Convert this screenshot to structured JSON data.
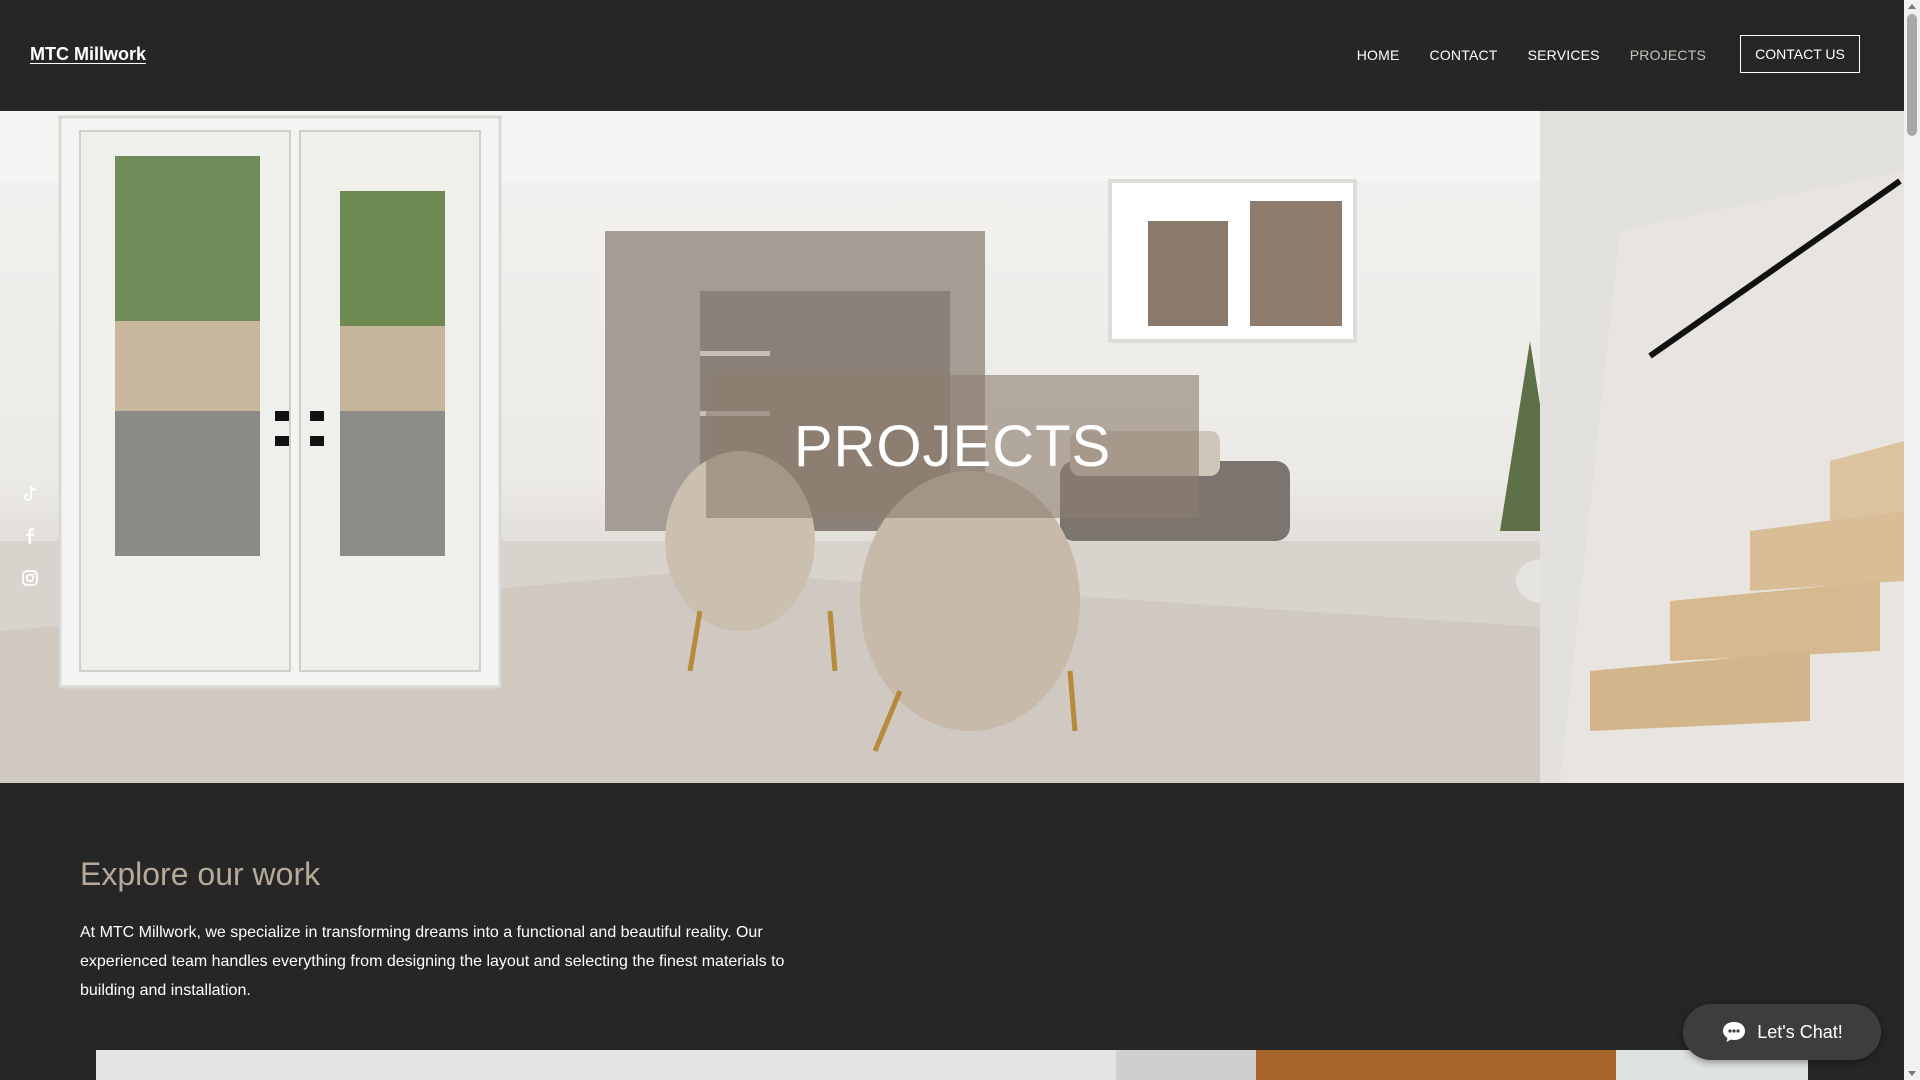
{
  "header": {
    "brand": "MTC Millwork",
    "nav": [
      {
        "label": "HOME",
        "active": false
      },
      {
        "label": "CONTACT",
        "active": false
      },
      {
        "label": "SERVICES",
        "active": false
      },
      {
        "label": "PROJECTS",
        "active": true
      }
    ],
    "cta_label": "CONTACT US"
  },
  "hero": {
    "title": "PROJECTS"
  },
  "social": [
    "tiktok-icon",
    "facebook-icon",
    "instagram-icon"
  ],
  "section": {
    "title": "Explore our work",
    "body": "At MTC Millwork, we specialize in transforming dreams into a functional and beautiful reality. Our experienced team handles everything from designing the layout and selecting the finest materials to building and installation."
  },
  "chat": {
    "label": "Let's Chat!"
  },
  "colors": {
    "background": "#262626",
    "accent": "#b5a99a",
    "active_nav": "#c8c1b8"
  }
}
